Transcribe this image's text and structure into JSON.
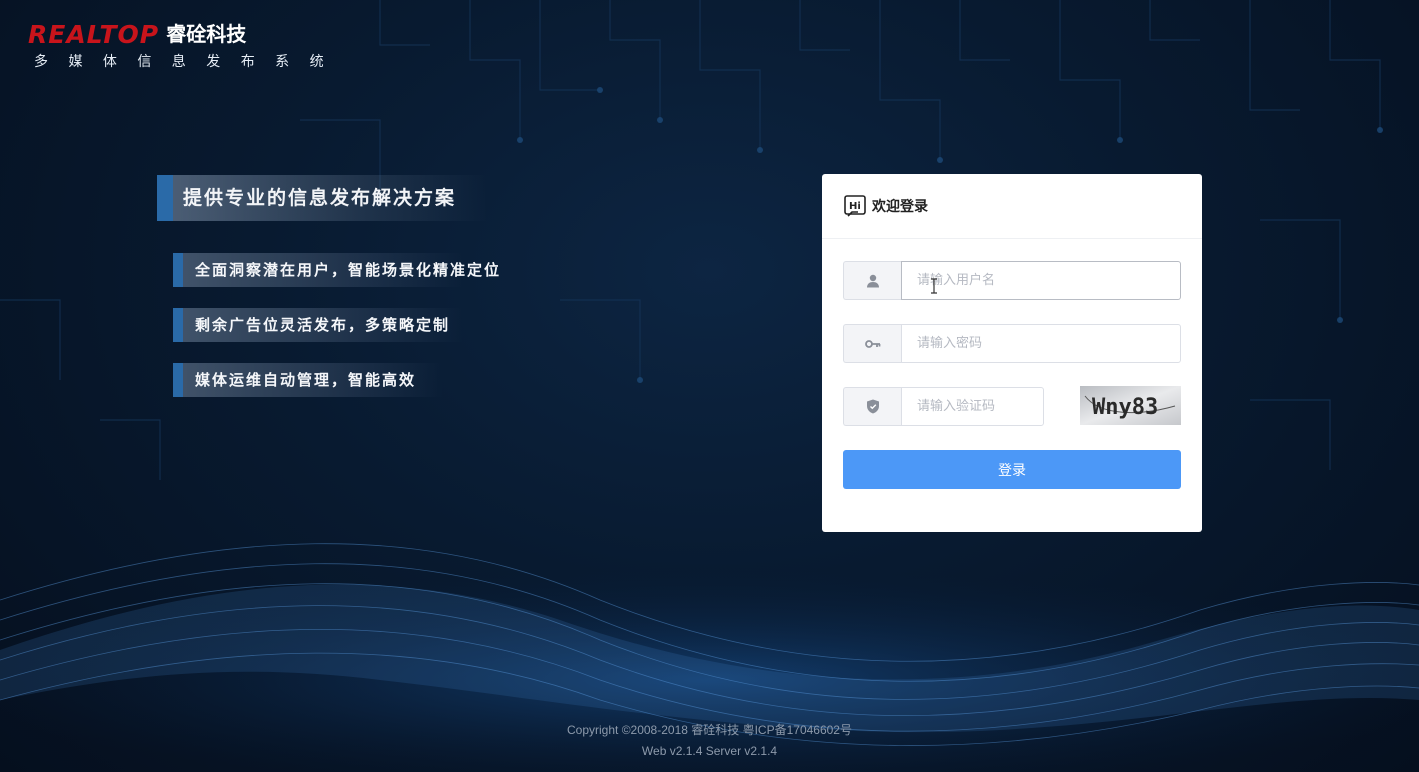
{
  "logo": {
    "brand": "REALTOP",
    "brand_cn": "睿硂科技",
    "subtitle": "多 媒 体 信 息 发 布 系 统"
  },
  "slogan": {
    "main": "提供专业的信息发布解决方案",
    "features": [
      "全面洞察潜在用户，智能场景化精准定位",
      "剩余广告位灵活发布，多策略定制",
      "媒体运维自动管理，智能高效"
    ]
  },
  "login": {
    "title": "欢迎登录",
    "hi_icon": "hi-icon",
    "username": {
      "value": "",
      "placeholder": "请输入用户名",
      "icon": "user-icon"
    },
    "password": {
      "value": "",
      "placeholder": "请输入密码",
      "icon": "key-icon"
    },
    "captcha": {
      "value": "",
      "placeholder": "请输入验证码",
      "icon": "shield-icon",
      "image_text": "Wny83"
    },
    "submit_label": "登录"
  },
  "footer": {
    "copyright": "Copyright ©2008-2018 睿硂科技 粤ICP备17046602号",
    "version": "Web v2.1.4 Server v2.1.4"
  },
  "colors": {
    "accent": "#4c98f7",
    "brand_red": "#c8141b",
    "background": "#081a30"
  }
}
